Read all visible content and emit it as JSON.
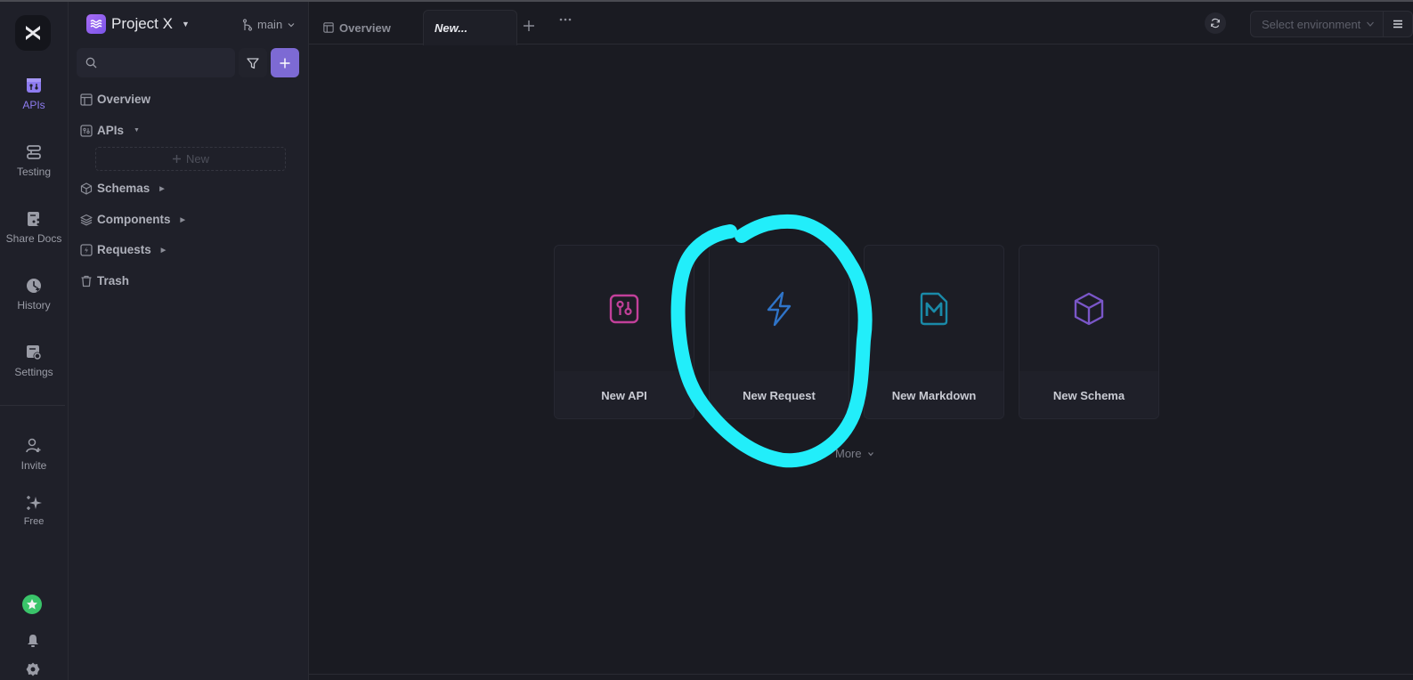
{
  "rail": {
    "items": [
      {
        "label": "APIs",
        "icon": "api-icon",
        "active": true
      },
      {
        "label": "Testing",
        "icon": "testing-icon"
      },
      {
        "label": "Share Docs",
        "icon": "share-docs-icon"
      },
      {
        "label": "History",
        "icon": "history-icon"
      },
      {
        "label": "Settings",
        "icon": "settings-icon"
      }
    ],
    "bottom": [
      {
        "label": "Invite",
        "icon": "invite-user-icon"
      },
      {
        "label": "Free",
        "icon": "sparkle-icon"
      }
    ]
  },
  "sidebar": {
    "project_name": "Project X",
    "branch": "main",
    "search_placeholder": "",
    "tree": [
      {
        "label": "Overview",
        "icon": "layout-icon"
      },
      {
        "label": "APIs",
        "icon": "api-icon",
        "expanded": true
      },
      {
        "label": "Schemas",
        "icon": "cube-icon"
      },
      {
        "label": "Components",
        "icon": "layers-icon"
      },
      {
        "label": "Requests",
        "icon": "lightning-icon"
      },
      {
        "label": "Trash",
        "icon": "trash-icon"
      }
    ],
    "new_label": "New"
  },
  "tabs": [
    {
      "label": "Overview",
      "icon": "layout-icon"
    },
    {
      "label": "New...",
      "active": true
    }
  ],
  "toolbar": {
    "environment_placeholder": "Select environment"
  },
  "cards": [
    {
      "label": "New API",
      "icon": "api-icon",
      "color": "#c2409a"
    },
    {
      "label": "New Request",
      "icon": "lightning-icon",
      "color": "#2f74c8"
    },
    {
      "label": "New Markdown",
      "icon": "markdown-icon",
      "color": "#1a8aa8"
    },
    {
      "label": "New Schema",
      "icon": "cube-icon",
      "color": "#7a56c8"
    }
  ],
  "more_label": "More",
  "colors": {
    "accent": "#7d6ad4",
    "annotation": "#22eefa"
  }
}
